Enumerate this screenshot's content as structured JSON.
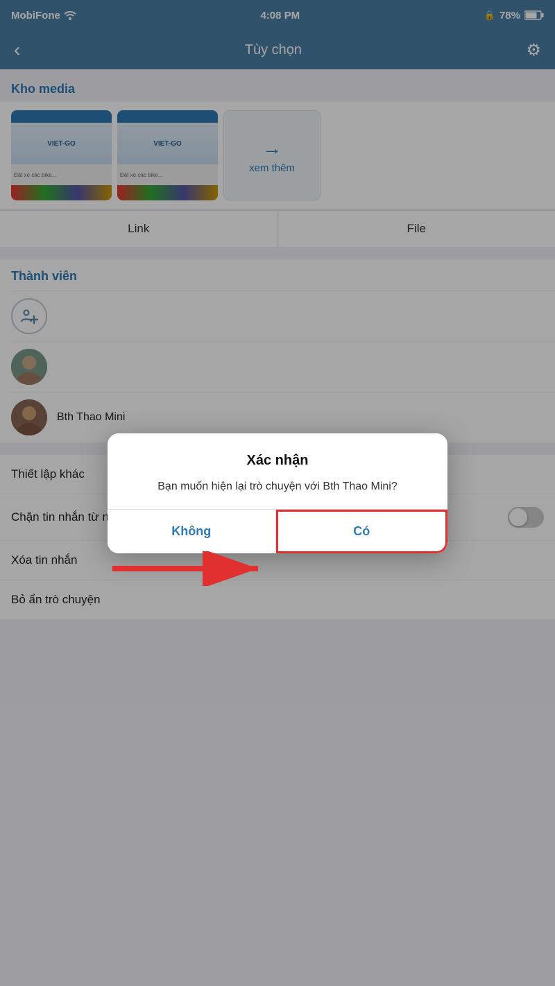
{
  "statusBar": {
    "carrier": "MobiFone",
    "time": "4:08 PM",
    "battery": "78%"
  },
  "navBar": {
    "backLabel": "‹",
    "title": "Tùy chọn",
    "gearIcon": "⚙"
  },
  "mediaSection": {
    "header": "Kho media",
    "moreArrow": "→",
    "moreLabel": "xem thêm"
  },
  "tabs": {
    "link": "Link",
    "file": "File"
  },
  "membersSection": {
    "header": "Thành viên",
    "members": [
      {
        "name": "Bth Thao Mini",
        "type": "photo"
      }
    ]
  },
  "settings": {
    "header": "Thiết lập khác",
    "items": [
      {
        "label": "Chặn tin nhắn từ người này",
        "hasToggle": true
      },
      {
        "label": "Xóa tin nhắn",
        "hasToggle": false
      },
      {
        "label": "Bỏ ẩn trò chuyện",
        "hasToggle": false
      }
    ]
  },
  "dialog": {
    "title": "Xác nhận",
    "message": "Bạn muốn hiện lại trò chuyện với Bth Thao Mini?",
    "cancelLabel": "Không",
    "confirmLabel": "Có"
  }
}
